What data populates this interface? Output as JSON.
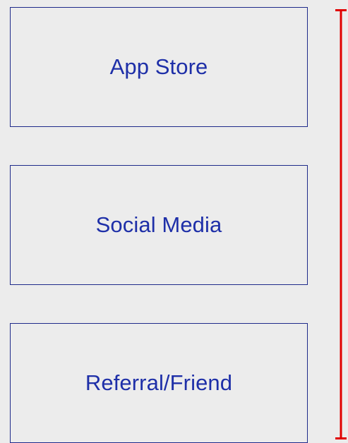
{
  "options": [
    {
      "label": "App Store"
    },
    {
      "label": "Social Media"
    },
    {
      "label": "Referral/Friend"
    }
  ],
  "colors": {
    "background": "#ececec",
    "box_border": "#1e2a8a",
    "label_text": "#1e2fa8",
    "bracket": "#e00000"
  }
}
